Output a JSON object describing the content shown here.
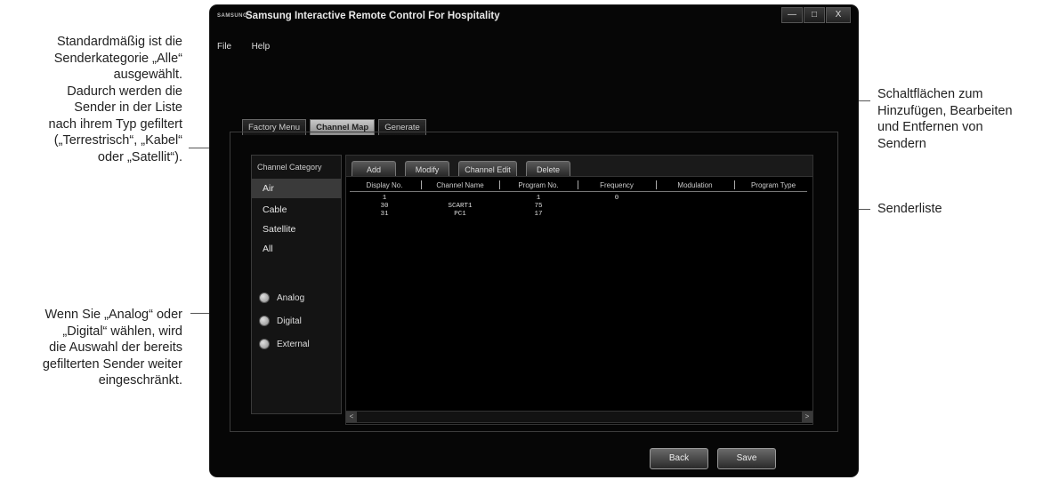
{
  "annotations": {
    "category_default": [
      "Standardmäßig ist die",
      "Senderkategorie „Alle“",
      "ausgewählt.",
      "Dadurch werden die",
      "Sender in der Liste",
      "nach ihrem Typ gefiltert",
      "(„Terrestrisch“, „Kabel“",
      "oder „Satellit“)."
    ],
    "analog_digital": [
      "Wenn Sie „Analog“ oder",
      "„Digital“ wählen, wird",
      "die Auswahl der bereits",
      "gefilterten Sender weiter",
      "eingeschränkt."
    ],
    "buttons": [
      "Schaltflächen zum",
      "Hinzufügen, Bearbeiten",
      "und Entfernen von",
      "Sendern"
    ],
    "list": "Senderliste"
  },
  "window": {
    "logo_text": "SAMSUNG",
    "title": "Samsung Interactive Remote Control For Hospitality",
    "controls": [
      "—",
      "□",
      "X"
    ]
  },
  "menu": [
    "File",
    "Help"
  ],
  "tabs": [
    {
      "label": "Factory Menu",
      "active": false
    },
    {
      "label": "Channel Map",
      "active": true
    },
    {
      "label": "Generate",
      "active": false
    }
  ],
  "category": {
    "header": "Channel Category",
    "items": [
      {
        "label": "Air",
        "selected": true
      },
      {
        "label": "Cable",
        "selected": false
      },
      {
        "label": "Satellite",
        "selected": false
      },
      {
        "label": "All",
        "selected": false
      }
    ],
    "radios": [
      "Analog",
      "Digital",
      "External"
    ]
  },
  "toolbar": [
    "Add",
    "Modify",
    "Channel Edit",
    "Delete"
  ],
  "list": {
    "columns": [
      "Display No.",
      "Channel Name",
      "Program No.",
      "Frequency",
      "Modulation",
      "Program Type"
    ],
    "rows": [
      [
        "1",
        "",
        "1",
        "0",
        "",
        ""
      ],
      [
        "30",
        "SCART1",
        "75",
        "",
        "",
        ""
      ],
      [
        "31",
        "PC1",
        "17",
        "",
        "",
        ""
      ]
    ]
  },
  "scroll": {
    "left": "<",
    "right": ">"
  },
  "footer": {
    "back": "Back",
    "save": "Save"
  }
}
